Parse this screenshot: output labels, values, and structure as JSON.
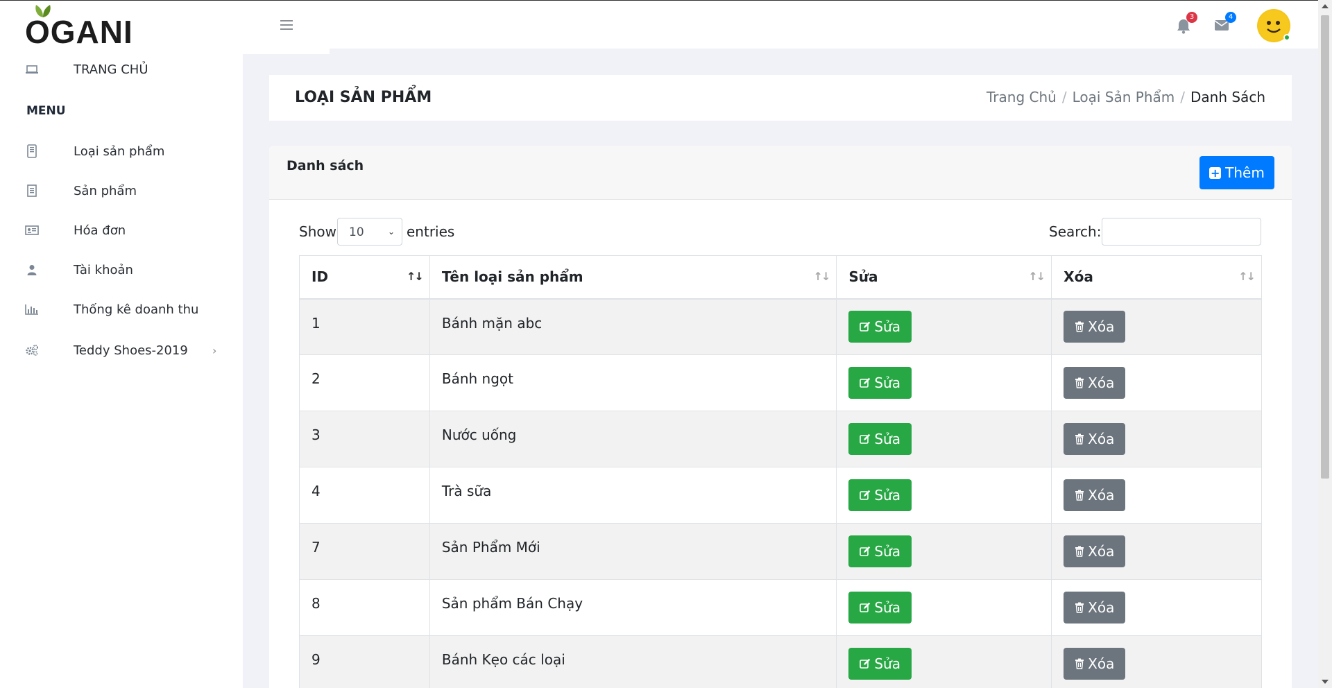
{
  "brand": {
    "name": "OGANI"
  },
  "header": {
    "notifications_count": "3",
    "messages_count": "4",
    "colors": {
      "notify_badge": "#dc3545",
      "message_badge": "#007bff"
    }
  },
  "sidebar": {
    "home": "TRANG CHỦ",
    "menu_title": "MENU",
    "items": [
      {
        "label": "Loại sản phẩm",
        "icon": "tablet-icon"
      },
      {
        "label": "Sản phẩm",
        "icon": "book-icon"
      },
      {
        "label": "Hóa đơn",
        "icon": "id-card-icon"
      },
      {
        "label": "Tài khoản",
        "icon": "user-icon"
      },
      {
        "label": "Thống kê doanh thu",
        "icon": "bar-chart-icon"
      },
      {
        "label": "Teddy Shoes-2019",
        "icon": "cogs-icon"
      }
    ]
  },
  "page": {
    "title": "LOẠI SẢN PHẨM",
    "breadcrumb": [
      "Trang Chủ",
      "Loại Sản Phẩm",
      "Danh Sách"
    ]
  },
  "card": {
    "title": "Danh sách",
    "add_label": "Thêm"
  },
  "table_controls": {
    "show_label": "Show",
    "page_size": "10",
    "entries_label": "entries",
    "search_label": "Search:",
    "search_value": ""
  },
  "table": {
    "columns": [
      "ID",
      "Tên loại sản phẩm",
      "Sửa",
      "Xóa"
    ],
    "edit_label": "Sửa",
    "delete_label": "Xóa",
    "rows": [
      {
        "id": "1",
        "name": "Bánh mặn abc"
      },
      {
        "id": "2",
        "name": "Bánh ngọt"
      },
      {
        "id": "3",
        "name": "Nước uống"
      },
      {
        "id": "4",
        "name": "Trà sữa"
      },
      {
        "id": "7",
        "name": "Sản Phẩm Mới"
      },
      {
        "id": "8",
        "name": "Sản phẩm Bán Chạy"
      },
      {
        "id": "9",
        "name": "Bánh Kẹo các loại"
      }
    ]
  }
}
